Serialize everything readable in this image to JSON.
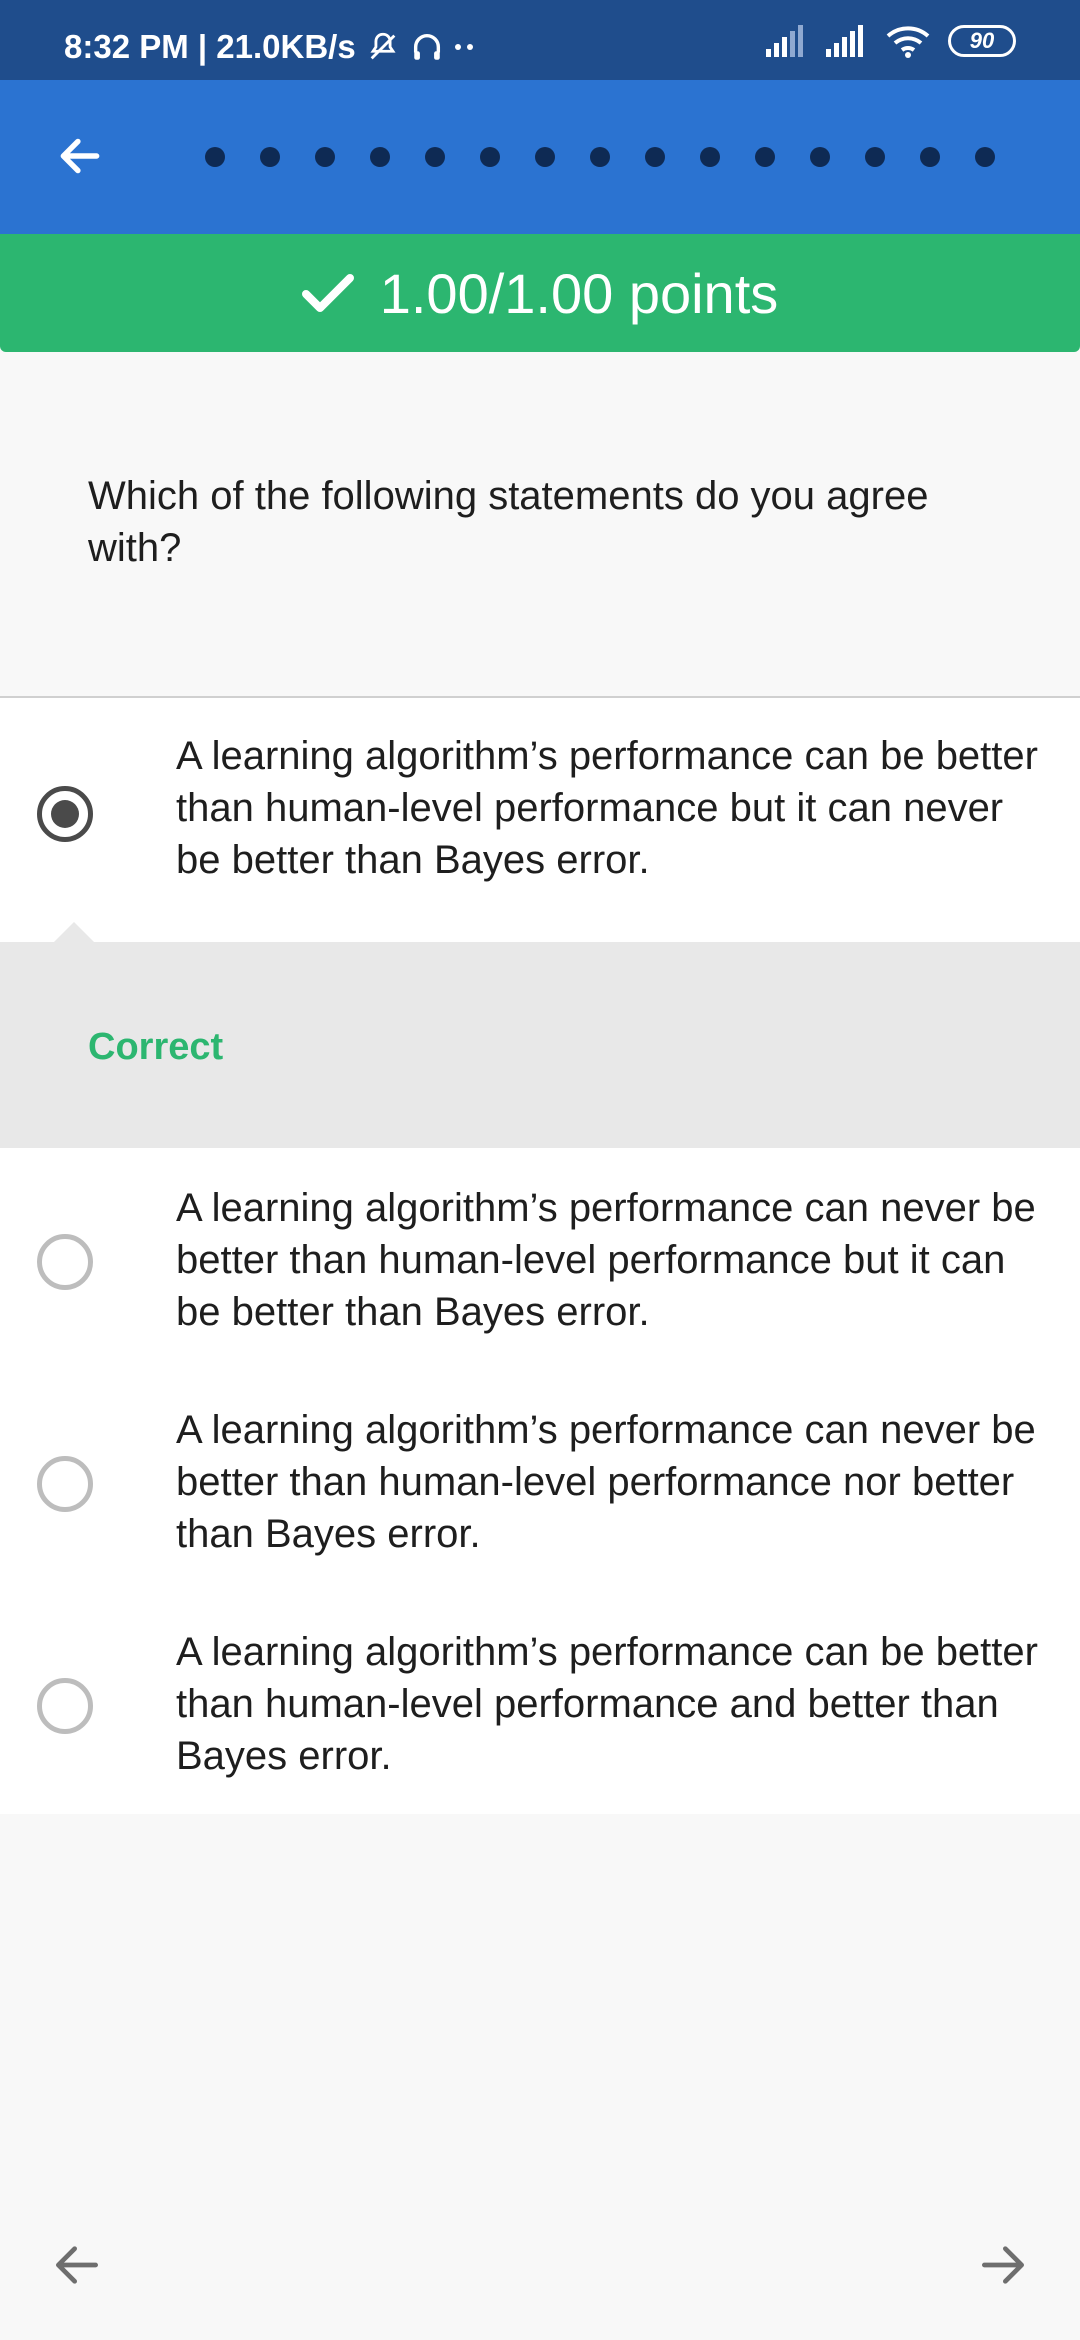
{
  "status_bar": {
    "time_speed": "8:32 PM | 21.0KB/s",
    "battery": "90"
  },
  "app_bar": {
    "back_icon": "arrow-left-icon",
    "progress_dot_count": 15
  },
  "score": {
    "text": "1.00/1.00 points",
    "icon": "check-icon",
    "color": "#2cb670"
  },
  "question": {
    "text": "Which of the following statements do you agree with?"
  },
  "options": [
    {
      "text": "A learning algorithm’s performance can be better than human-level performance but it can never be better than Bayes error.",
      "selected": true
    },
    {
      "text": "A learning algorithm’s performance can never be better than human-level performance but it can be better than Bayes error.",
      "selected": false
    },
    {
      "text": "A learning algorithm’s performance can never be better than human-level performance nor better than Bayes error.",
      "selected": false
    },
    {
      "text": "A learning algorithm’s performance can be better than human-level performance and better than Bayes error.",
      "selected": false
    }
  ],
  "feedback": {
    "label": "Correct"
  },
  "bottom_nav": {
    "prev_icon": "arrow-left-icon",
    "next_icon": "arrow-right-icon"
  },
  "colors": {
    "status_bar": "#1f4d8c",
    "app_bar": "#2b73d1",
    "success": "#2cb670"
  }
}
